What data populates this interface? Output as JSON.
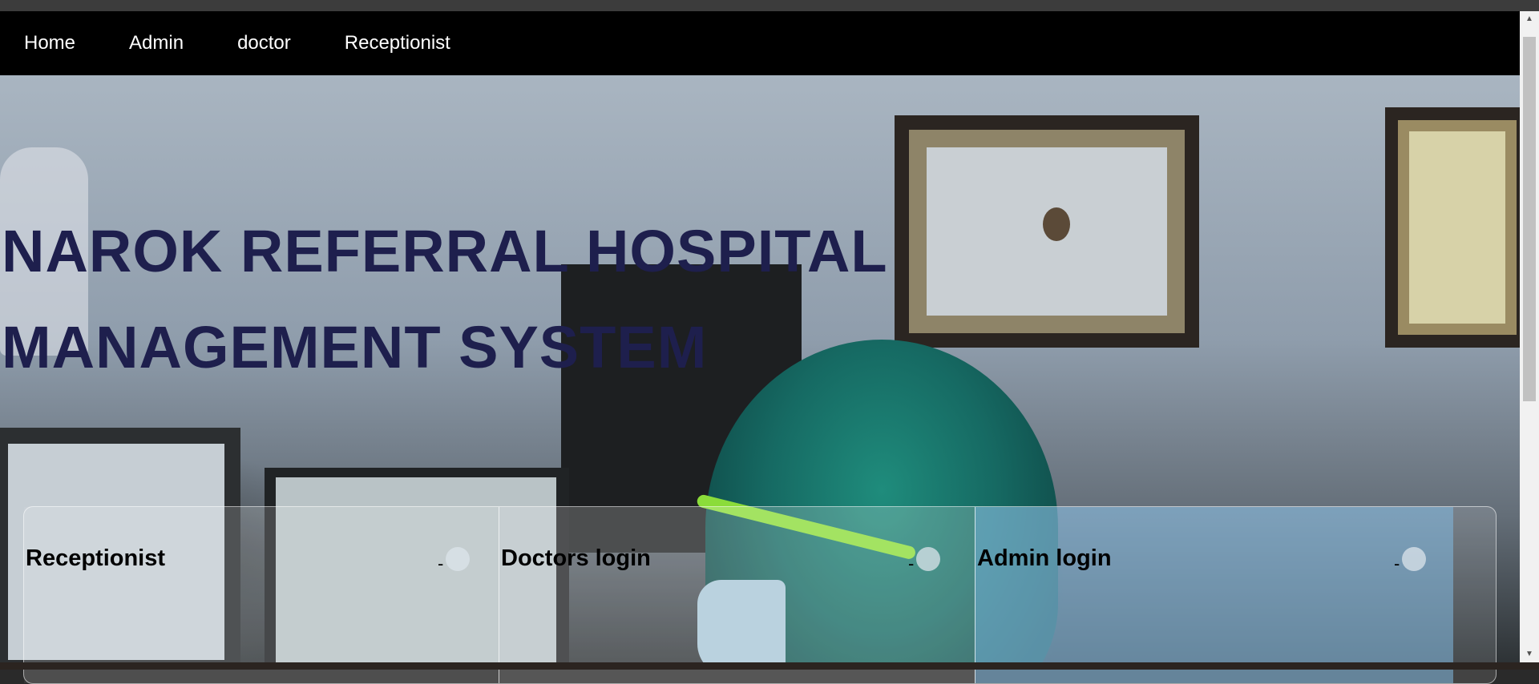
{
  "nav": {
    "items": [
      {
        "label": "Home"
      },
      {
        "label": "Admin"
      },
      {
        "label": "doctor"
      },
      {
        "label": "Receptionist"
      }
    ]
  },
  "hero": {
    "title_line1": "NAROK REFERRAL HOSPITAL",
    "title_line2": "MANAGEMENT SYSTEM"
  },
  "cards": [
    {
      "title": "Receptionist",
      "dash": "-"
    },
    {
      "title": "Doctors login",
      "dash": "-"
    },
    {
      "title": "Admin login",
      "dash": "-"
    }
  ],
  "colors": {
    "navbar_bg": "#000000",
    "title_color": "#1e1f4d",
    "admin_card_tint": "#82b9e1"
  }
}
